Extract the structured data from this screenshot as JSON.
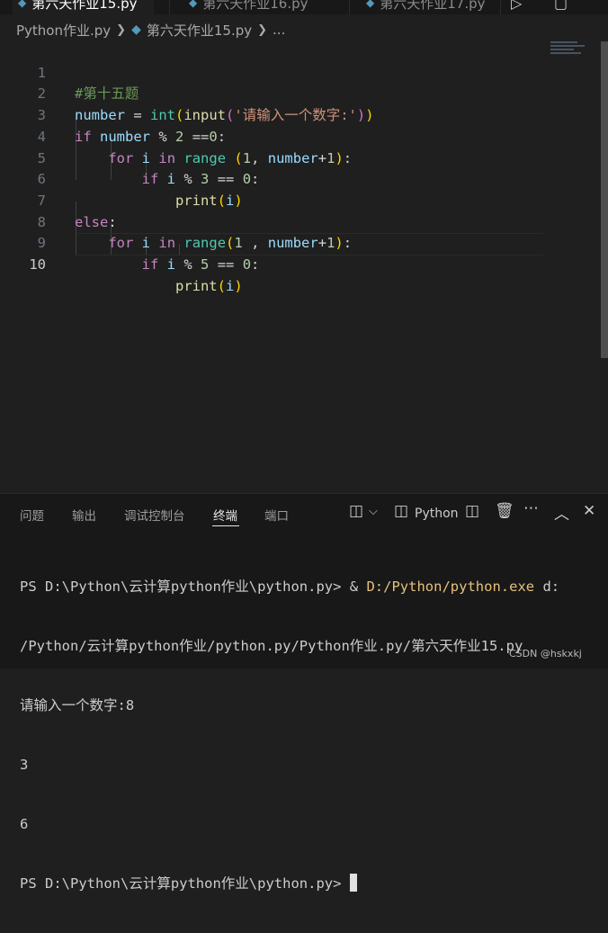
{
  "tabs": {
    "items": [
      {
        "label": "第六天作业15.py",
        "active": true
      },
      {
        "label": "第六天作业16.py",
        "active": false
      },
      {
        "label": "第六天作业17.py",
        "active": false
      }
    ]
  },
  "breadcrumb": {
    "folder": "Python作业.py",
    "file": "第六天作业15.py",
    "more": "..."
  },
  "editor": {
    "line_numbers": [
      "1",
      "2",
      "3",
      "4",
      "5",
      "6",
      "7",
      "8",
      "9",
      "10"
    ],
    "current_line": "10",
    "code_lines": [
      "#第十五题",
      "number = int(input('请输入一个数字:'))",
      "if number % 2 ==0:",
      "    for i in range (1, number+1):",
      "        if i % 3 == 0:",
      "            print(i)",
      "else:",
      "    for i in range(1 , number+1):",
      "        if i % 5 == 0:",
      "            print(i)"
    ]
  },
  "panel": {
    "tabs": [
      "问题",
      "输出",
      "调试控制台",
      "终端",
      "端口"
    ],
    "active_tab": "终端",
    "terminal_profile": "Python",
    "icons": [
      "split-editor-icon",
      "chevron-down-icon",
      "terminal-panel-icon",
      "split-terminal-icon",
      "trash-icon",
      "more-icon",
      "chevron-up-icon",
      "close-icon"
    ]
  },
  "terminal": {
    "prompt1": "PS D:\\Python\\云计算python作业\\python.py> ",
    "cmd_amp": "& ",
    "cmd_exe": "D:/Python/python.exe",
    "cmd_arg1": " d:",
    "cmd_arg2": "/Python/云计算python作业/python.py/Python作业.py/第六天作业15.py",
    "input_prompt": "请输入一个数字:8",
    "out1": "3",
    "out2": "6",
    "prompt2": "PS D:\\Python\\云计算python作业\\python.py> "
  },
  "watermark": "CSDN @hskxkj",
  "colors": {
    "editor_bg": "#1f1f1f",
    "panel_bg": "#181818",
    "keyword": "#c586c0",
    "variable": "#9cdcfe",
    "function": "#dcdcaa",
    "builtin_class": "#4ec9b0",
    "number": "#b5cea8",
    "string": "#ce9178",
    "comment": "#6a9955"
  }
}
